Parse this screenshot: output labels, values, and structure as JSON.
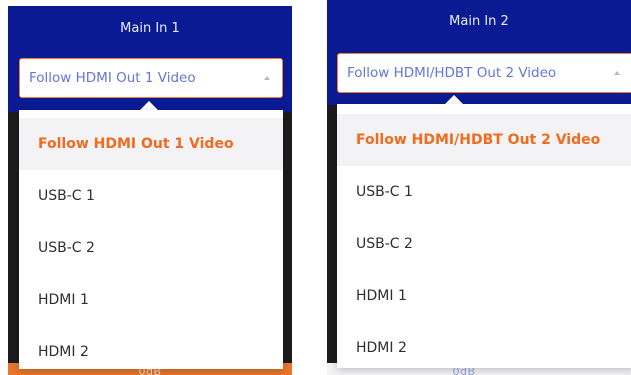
{
  "panels": [
    {
      "title": "Main In 1",
      "select_value": "Follow HDMI Out 1 Video",
      "options": [
        "Follow HDMI Out 1 Video",
        "USB-C 1",
        "USB-C 2",
        "HDMI 1",
        "HDMI 2"
      ],
      "selected_index": 0,
      "footer_text": "0dB"
    },
    {
      "title": "Main In 2",
      "select_value": "Follow HDMI/HDBT Out 2 Video",
      "options": [
        "Follow HDMI/HDBT Out 2 Video",
        "USB-C 1",
        "USB-C 2",
        "HDMI 1",
        "HDMI 2"
      ],
      "selected_index": 0,
      "footer_text": "0dB"
    }
  ],
  "colors": {
    "header_bg": "#0a1a93",
    "select_border": "#f07c2d",
    "select_text": "#6577d6",
    "selected_option_text": "#f06b1e",
    "selected_option_bg": "#f3f3f6",
    "option_text": "#2f2f2f",
    "footer_accent": "#e8762b"
  }
}
